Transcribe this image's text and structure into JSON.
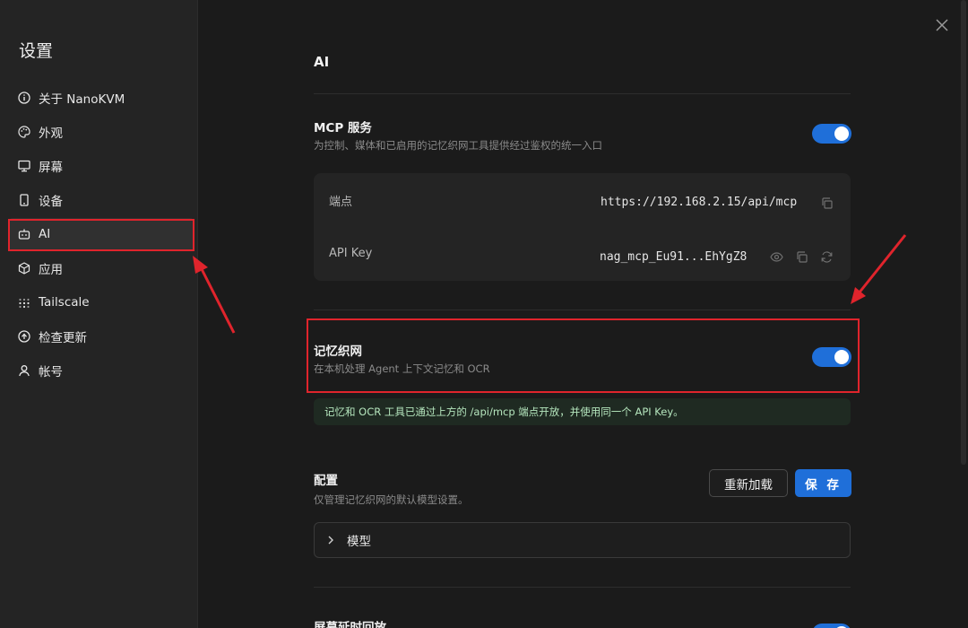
{
  "sidebar": {
    "title": "设置",
    "items": [
      {
        "label": "关于 NanoKVM",
        "icon": "info-icon"
      },
      {
        "label": "外观",
        "icon": "palette-icon"
      },
      {
        "label": "屏幕",
        "icon": "monitor-icon"
      },
      {
        "label": "设备",
        "icon": "device-icon"
      },
      {
        "label": "AI",
        "icon": "bot-icon",
        "active": true
      },
      {
        "label": "应用",
        "icon": "package-icon"
      },
      {
        "label": "Tailscale",
        "icon": "tailscale-icon"
      },
      {
        "label": "检查更新",
        "icon": "update-icon"
      },
      {
        "label": "帐号",
        "icon": "user-icon"
      }
    ]
  },
  "main": {
    "section_title": "AI",
    "mcp": {
      "title": "MCP 服务",
      "description": "为控制、媒体和已启用的记忆织网工具提供经过鉴权的统一入口",
      "enabled": true,
      "endpoint_label": "端点",
      "endpoint_value": "https://192.168.2.15/api/mcp",
      "apikey_label": "API Key",
      "apikey_value": "nag_mcp_Eu91...EhYgZ8"
    },
    "memory": {
      "title": "记忆织网",
      "description": "在本机处理 Agent 上下文记忆和 OCR",
      "enabled": true,
      "info": "记忆和 OCR 工具已通过上方的 /api/mcp 端点开放，并使用同一个 API Key。"
    },
    "config": {
      "title": "配置",
      "description": "仅管理记忆织网的默认模型设置。",
      "reload_label": "重新加载",
      "save_label": "保 存",
      "model_label": "模型"
    },
    "next_section_title": "屏幕延时回放"
  },
  "colors": {
    "accent": "#1f6fd9",
    "highlight": "#e0242c",
    "info_text": "#b5e6bd"
  }
}
